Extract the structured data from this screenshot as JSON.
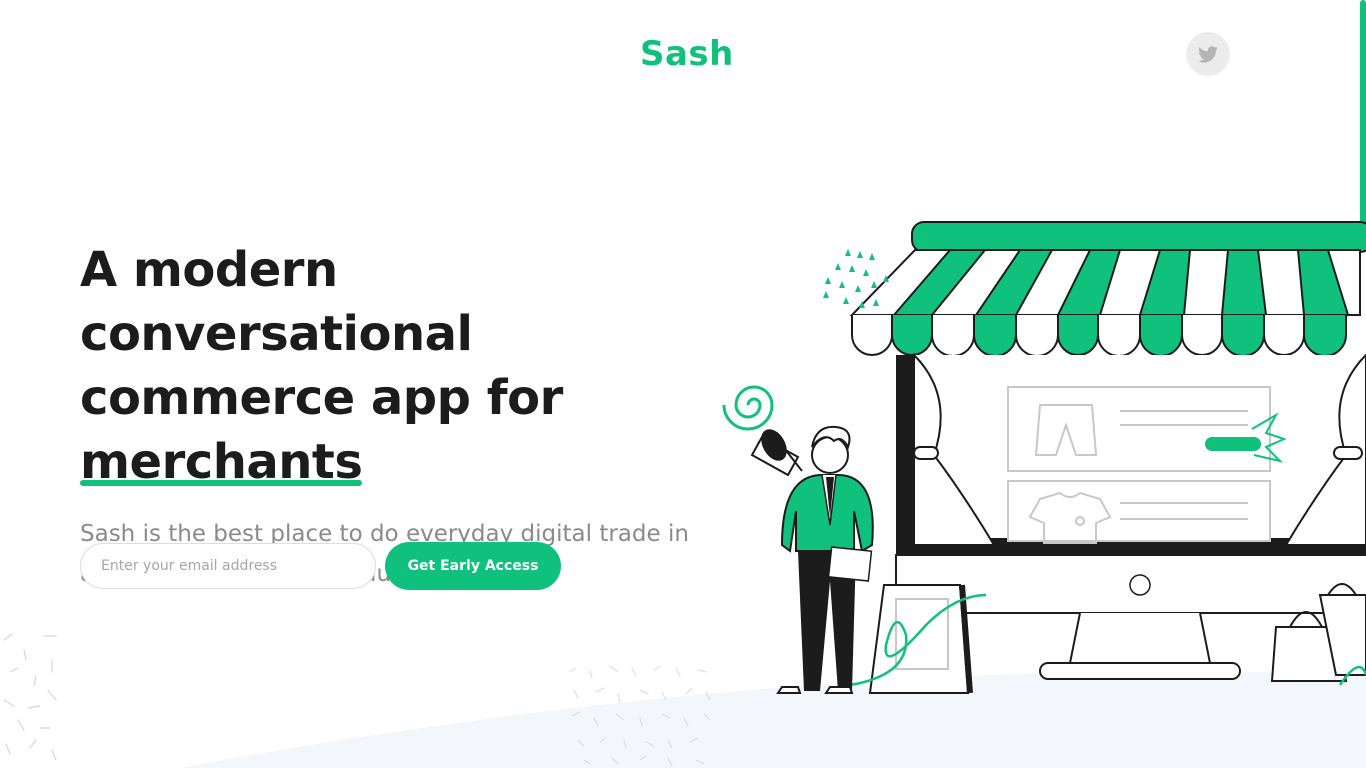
{
  "header": {
    "logo": "Sash",
    "social_icon": "twitter-icon"
  },
  "hero": {
    "headline_line1": "A modern conversational",
    "headline_line2": "commerce app for",
    "headline_highlight": "merchants",
    "subtitle": "Sash is the best place to do everyday digital trade in a seamless, fast and productive way."
  },
  "signup": {
    "email_placeholder": "Enter your email address",
    "email_value": "",
    "cta_label": "Get Early Access"
  },
  "colors": {
    "accent": "#10c17d",
    "text_dark": "#1c1c1c",
    "text_muted": "#8a8a8a",
    "background": "#ffffff",
    "wave": "#f3f6fb"
  },
  "illustration": {
    "icons": [
      "shop-illustration",
      "megaphone-icon",
      "shopping-bag-icon",
      "shorts-icon",
      "tshirt-icon"
    ]
  }
}
